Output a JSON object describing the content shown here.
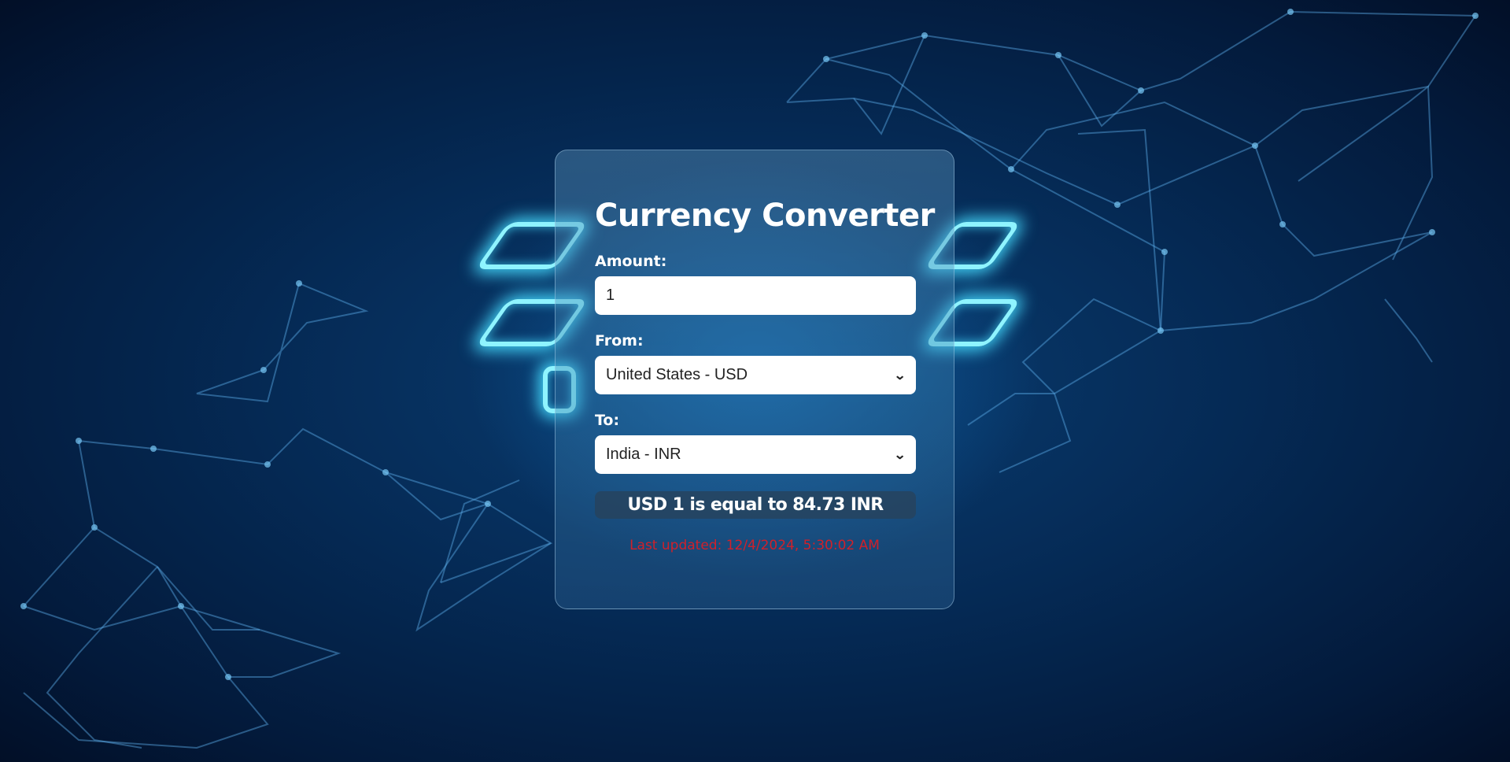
{
  "converter": {
    "title": "Currency Converter",
    "amount_label": "Amount:",
    "amount_value": "1",
    "from_label": "From:",
    "from_selected": "United States - USD",
    "to_label": "To:",
    "to_selected": "India - INR",
    "result_text": "USD 1 is equal to 84.73 INR",
    "last_updated": "Last updated: 12/4/2024, 5:30:02 AM"
  },
  "colors": {
    "background": "#052a55",
    "card_border": "#b4d7f0",
    "result_bg": "#28415a",
    "updated_text": "#d0202a",
    "neon_glow": "#46dcff"
  },
  "icons": {
    "select_arrow": "chevron-down-icon"
  }
}
